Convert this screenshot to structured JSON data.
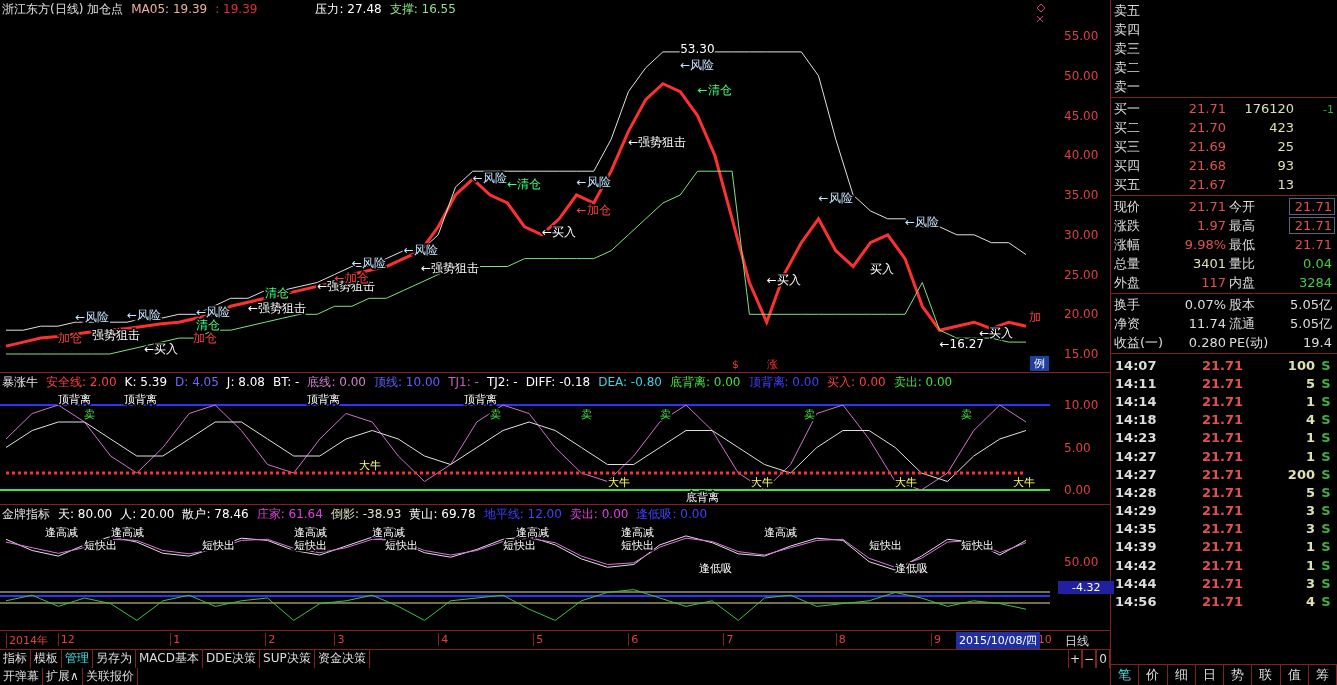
{
  "main": {
    "header": [
      {
        "text": "浙江东方(日线) 加仓点"
      },
      {
        "text": "MA05: 19.39",
        "color": "#f0b0a0"
      },
      {
        "text": ": 19.39",
        "color": "#e03030"
      },
      {
        "text": "压力: 27.48",
        "color": "#ffffff"
      },
      {
        "text": "支撑: 16.55",
        "color": "#90e090"
      }
    ],
    "chart_data": {
      "type": "line",
      "ylim": [
        15,
        55
      ],
      "yticks": [
        {
          "value": 55,
          "label": "55.00"
        },
        {
          "value": 50,
          "label": "50.00"
        },
        {
          "value": 45,
          "label": "45.00"
        },
        {
          "value": 40,
          "label": "40.00"
        },
        {
          "value": 35,
          "label": "35.00"
        },
        {
          "value": 30,
          "label": "30.00"
        },
        {
          "value": 25,
          "label": "25.00"
        },
        {
          "value": 20,
          "label": "20.00"
        },
        {
          "value": 15,
          "label": "15.00"
        }
      ],
      "series": [
        {
          "color": "#ff3030",
          "values": [
            16,
            16.5,
            17,
            17.2,
            17.5,
            17.8,
            18,
            18.2,
            18.5,
            18.8,
            19,
            19.5,
            20,
            21,
            21.5,
            22,
            22.5,
            23,
            23.5,
            24,
            25,
            25.5,
            26,
            27,
            28,
            31,
            35,
            37,
            35,
            34,
            31,
            30,
            32,
            35,
            34,
            38,
            43,
            47,
            49,
            48,
            45,
            40,
            32,
            24,
            19,
            25,
            29,
            32,
            28,
            26,
            29,
            30,
            27,
            21,
            18,
            18.5,
            19,
            18.2,
            19,
            18.5
          ]
        },
        {
          "color": "#e0e0e0",
          "values": [
            18,
            18,
            18.5,
            18.5,
            19,
            19,
            19,
            19,
            19.5,
            19.5,
            20,
            20,
            21,
            22,
            22,
            23,
            23,
            23.5,
            24,
            25,
            26,
            26,
            27,
            28,
            28,
            30,
            36,
            38,
            38,
            38,
            38,
            38,
            38,
            38,
            38,
            42,
            48,
            51,
            53,
            53,
            53,
            53,
            53,
            53,
            53,
            53,
            53,
            50,
            42,
            35,
            33,
            32,
            32,
            31,
            31,
            30,
            30,
            29,
            29,
            27.5
          ]
        },
        {
          "color": "#80e080",
          "values": [
            15,
            15,
            15,
            15,
            15,
            15,
            15,
            15.5,
            16,
            16.5,
            17,
            17,
            18,
            18,
            18.5,
            19,
            19.5,
            20,
            20,
            21,
            21,
            22,
            22,
            23,
            24,
            25,
            26,
            26,
            26,
            26,
            27,
            27,
            27,
            27,
            27,
            28,
            30,
            32,
            34,
            35,
            38,
            38,
            38,
            20,
            20,
            20,
            20,
            20,
            20,
            20,
            20,
            20,
            20,
            24,
            18,
            17,
            17,
            17,
            16.5,
            16.5
          ]
        }
      ]
    },
    "signals": [
      {
        "text": "加仓",
        "kind": "add"
      },
      {
        "text": "←风险",
        "kind": "risk"
      },
      {
        "text": "强势狙击",
        "kind": "strong"
      },
      {
        "text": "←风险",
        "kind": "risk"
      },
      {
        "text": "←买入",
        "kind": "buy"
      },
      {
        "text": "←风险",
        "kind": "risk"
      },
      {
        "text": "清仓",
        "kind": "clear"
      },
      {
        "text": "加仓",
        "kind": "add"
      },
      {
        "text": "←强势狙击",
        "kind": "strong"
      },
      {
        "text": "清仓",
        "kind": "clear"
      },
      {
        "text": "←强势狙击",
        "kind": "strong"
      },
      {
        "text": "←加仓",
        "kind": "add"
      },
      {
        "text": "←风险",
        "kind": "risk"
      },
      {
        "text": "←风险",
        "kind": "risk"
      },
      {
        "text": "←强势狙击",
        "kind": "strong"
      },
      {
        "text": "←风险",
        "kind": "risk"
      },
      {
        "text": "←清仓",
        "kind": "clear"
      },
      {
        "text": "←买入",
        "kind": "buy"
      },
      {
        "text": "←风险",
        "kind": "risk"
      },
      {
        "text": "←加仓",
        "kind": "add"
      },
      {
        "text": "←强势狙击",
        "kind": "strong"
      },
      {
        "text": "53.30",
        "kind": "price"
      },
      {
        "text": "←风险",
        "kind": "risk"
      },
      {
        "text": "←清仓",
        "kind": "clear"
      },
      {
        "text": "←买入",
        "kind": "buy"
      },
      {
        "text": "←风险",
        "kind": "risk"
      },
      {
        "text": "买入",
        "kind": "buy"
      },
      {
        "text": "←风险",
        "kind": "risk"
      },
      {
        "text": "←16.27",
        "kind": "price"
      },
      {
        "text": "←买入",
        "kind": "buy"
      },
      {
        "text": "加",
        "kind": "add"
      }
    ],
    "markers": [
      "$",
      "涨"
    ],
    "legend_tag": "例"
  },
  "osc": {
    "header": [
      {
        "text": "暴涨牛"
      },
      {
        "text": "安全线: 2.00",
        "color": "#ff4040"
      },
      {
        "text": "K: 5.39",
        "color": "#ffffff"
      },
      {
        "text": "D: 4.05",
        "color": "#6a6aff"
      },
      {
        "text": "J: 8.08",
        "color": "#ffffff"
      },
      {
        "text": "BT: -",
        "color": "#ffffff"
      },
      {
        "text": "底线: 0.00",
        "color": "#d080d0"
      },
      {
        "text": "顶线: 10.00",
        "color": "#6060ff"
      },
      {
        "text": "TJ1: -",
        "color": "#c060c0"
      },
      {
        "text": "TJ2: -",
        "color": "#ffffff"
      },
      {
        "text": "DIFF: -0.18",
        "color": "#ffffff"
      },
      {
        "text": "DEA: -0.80",
        "color": "#40d0e0"
      },
      {
        "text": "底背离: 0.00",
        "color": "#40e040"
      },
      {
        "text": "顶背离: 0.00",
        "color": "#4040ff"
      },
      {
        "text": "买入: 0.00",
        "color": "#ff4040"
      },
      {
        "text": "卖出: 0.00",
        "color": "#40e040"
      }
    ],
    "chart_data": {
      "type": "line",
      "ylim": [
        0,
        10
      ],
      "yticks": [
        {
          "value": 10,
          "label": "10.00"
        },
        {
          "value": 5,
          "label": "5.00"
        },
        {
          "value": 0,
          "label": "0.00"
        }
      ],
      "series": [
        {
          "color": "#d070d0",
          "values": [
            6,
            9,
            10,
            8,
            4,
            2,
            5,
            9,
            10,
            7,
            3,
            2,
            6,
            9,
            8,
            4,
            1,
            3,
            8,
            10,
            9,
            5,
            2,
            1,
            4,
            8,
            10,
            7,
            2,
            0,
            3,
            9,
            10,
            6,
            1,
            0,
            2,
            7,
            10,
            8
          ]
        },
        {
          "color": "#e0e0e0",
          "values": [
            5,
            7,
            8,
            8,
            6,
            4,
            4,
            6,
            8,
            8,
            6,
            4,
            4,
            6,
            7,
            6,
            4,
            3,
            5,
            7,
            8,
            7,
            5,
            3,
            3,
            5,
            7,
            7,
            5,
            3,
            2,
            5,
            7,
            7,
            5,
            2,
            1,
            4,
            6,
            7
          ]
        },
        {
          "color": "#ff3030",
          "line_style": "dotted",
          "values": [
            2,
            2,
            2,
            2,
            2,
            2,
            2,
            2,
            2,
            2,
            2,
            2,
            2,
            2,
            2,
            2,
            2,
            2,
            2,
            2,
            2,
            2,
            2,
            2,
            2,
            2,
            2,
            2,
            2,
            2,
            2,
            2,
            2,
            2,
            2,
            2,
            2,
            2,
            2,
            2
          ]
        }
      ]
    },
    "signals": [
      {
        "text": "顶背离",
        "kind": "top"
      },
      {
        "text": "顶背离",
        "kind": "top"
      },
      {
        "text": "顶背离",
        "kind": "top"
      },
      {
        "text": "顶背离",
        "kind": "top"
      },
      {
        "text": "卖",
        "kind": "sell"
      },
      {
        "text": "卖",
        "kind": "sell"
      },
      {
        "text": "卖",
        "kind": "sell"
      },
      {
        "text": "卖",
        "kind": "sell"
      },
      {
        "text": "卖",
        "kind": "sell"
      },
      {
        "text": "卖",
        "kind": "sell"
      },
      {
        "text": "大牛",
        "kind": "bull"
      },
      {
        "text": "大牛",
        "kind": "bull"
      },
      {
        "text": "大牛",
        "kind": "bull"
      },
      {
        "text": "大牛",
        "kind": "bull"
      },
      {
        "text": "大牛",
        "kind": "bull"
      },
      {
        "text": "底背离",
        "kind": "bottom"
      }
    ]
  },
  "gold": {
    "header": [
      {
        "text": "金牌指标"
      },
      {
        "text": "天: 80.00",
        "color": "#ffffff"
      },
      {
        "text": "人: 20.00",
        "color": "#ffffff"
      },
      {
        "text": "散户: 78.46",
        "color": "#ffffff"
      },
      {
        "text": "庄家: 61.64",
        "color": "#e040e0"
      },
      {
        "text": "倒影: -38.93",
        "color": "#e0e0c0"
      },
      {
        "text": "黄山: 69.78",
        "color": "#ffffff"
      },
      {
        "text": "地平线: 12.00",
        "color": "#4040ff"
      },
      {
        "text": "卖出: 0.00",
        "color": "#e040e0"
      },
      {
        "text": "逢低吸: 0.00",
        "color": "#4040ff"
      }
    ],
    "axis_label": "50.00",
    "readout": "-4.32",
    "signals": [
      "逢高减",
      "逢高减",
      "逢高减",
      "逢高减",
      "逢高减",
      "逢高减",
      "逢高减",
      "短快出",
      "短快出",
      "短快出",
      "短快出",
      "短快出",
      "短快出",
      "短快出",
      "短快出",
      "逢低吸",
      "逢低吸"
    ]
  },
  "date_axis": [
    "2014年",
    "12",
    "1",
    "2",
    "3",
    "4",
    "5",
    "6",
    "7",
    "8",
    "9",
    "10"
  ],
  "cursor_date": "2015/10/08/四",
  "period": "日线",
  "toolbar": {
    "tabs": [
      {
        "label": "指标",
        "selected": false
      },
      {
        "label": "模板",
        "selected": false
      },
      {
        "label": "管理",
        "selected": true
      },
      {
        "label": "另存为",
        "selected": false
      },
      {
        "label": "MACD基本",
        "selected": false
      },
      {
        "label": "DDE决策",
        "selected": false
      },
      {
        "label": "SUP决策",
        "selected": false
      },
      {
        "label": "资金决策",
        "selected": false
      }
    ],
    "buttons": [
      "+",
      "−",
      "0"
    ],
    "links": [
      "开弹幕",
      "扩展∧",
      "关联报价"
    ]
  },
  "quote": {
    "sell": [
      "卖五",
      "卖四",
      "卖三",
      "卖二",
      "卖一"
    ],
    "buy": [
      {
        "label": "买一",
        "price": "21.71",
        "volume": "176120",
        "change": "-1"
      },
      {
        "label": "买二",
        "price": "21.70",
        "volume": "423"
      },
      {
        "label": "买三",
        "price": "21.69",
        "volume": "25"
      },
      {
        "label": "买四",
        "price": "21.68",
        "volume": "93"
      },
      {
        "label": "买五",
        "price": "21.67",
        "volume": "13"
      }
    ],
    "stats": [
      {
        "label": "现价",
        "value": {
          "text": "21.71",
          "color": "#e05050"
        },
        "label2": "今开",
        "value2": {
          "text": "21.71",
          "color": "#e05050",
          "boxed": true
        }
      },
      {
        "label": "涨跌",
        "value": {
          "text": "1.97",
          "color": "#e05050"
        },
        "label2": "最高",
        "value2": {
          "text": "21.71",
          "color": "#e05050",
          "boxed": true
        }
      },
      {
        "label": "涨幅",
        "value": {
          "text": "9.98%",
          "color": "#e05050"
        },
        "label2": "最低",
        "value2": {
          "text": "21.71",
          "color": "#e05050",
          "boxed": false
        }
      },
      {
        "label": "总量",
        "value": {
          "text": "3401",
          "color": "#e0e0b0"
        },
        "label2": "量比",
        "value2": {
          "text": "0.04",
          "color": "#40d040",
          "boxed": false
        }
      },
      {
        "label": "外盘",
        "value": {
          "text": "117",
          "color": "#e05050"
        },
        "label2": "内盘",
        "value2": {
          "text": "3284",
          "color": "#40d040",
          "boxed": false
        }
      }
    ],
    "finance": [
      {
        "label": "换手",
        "value": "0.07%",
        "label2": "股本",
        "value2": "5.05亿"
      },
      {
        "label": "净资",
        "value": "11.74",
        "label2": "流通",
        "value2": "5.05亿"
      },
      {
        "label": "收益(一)",
        "value": "0.280",
        "label2": "PE(动)",
        "value2": "19.4"
      }
    ],
    "ticks": [
      {
        "time": "14:07",
        "price": "21.71",
        "volume": "100",
        "side": "S"
      },
      {
        "time": "14:11",
        "price": "21.71",
        "volume": "5",
        "side": "S"
      },
      {
        "time": "14:14",
        "price": "21.71",
        "volume": "1",
        "side": "S"
      },
      {
        "time": "14:18",
        "price": "21.71",
        "volume": "4",
        "side": "S"
      },
      {
        "time": "14:23",
        "price": "21.71",
        "volume": "1",
        "side": "S"
      },
      {
        "time": "14:27",
        "price": "21.71",
        "volume": "1",
        "side": "S"
      },
      {
        "time": "14:27",
        "price": "21.71",
        "volume": "200",
        "side": "S"
      },
      {
        "time": "14:28",
        "price": "21.71",
        "volume": "5",
        "side": "S"
      },
      {
        "time": "14:29",
        "price": "21.71",
        "volume": "3",
        "side": "S"
      },
      {
        "time": "14:35",
        "price": "21.71",
        "volume": "3",
        "side": "S"
      },
      {
        "time": "14:39",
        "price": "21.71",
        "volume": "1",
        "side": "S"
      },
      {
        "time": "14:42",
        "price": "21.71",
        "volume": "1",
        "side": "S"
      },
      {
        "time": "14:44",
        "price": "21.71",
        "volume": "3",
        "side": "S"
      },
      {
        "time": "14:56",
        "price": "21.71",
        "volume": "4",
        "side": "S"
      }
    ],
    "tabs": [
      {
        "label": "笔",
        "selected": true
      },
      {
        "label": "价",
        "selected": false
      },
      {
        "label": "细",
        "selected": false
      },
      {
        "label": "日",
        "selected": false
      },
      {
        "label": "势",
        "selected": false
      },
      {
        "label": "联",
        "selected": false
      },
      {
        "label": "值",
        "selected": false
      },
      {
        "label": "筹",
        "selected": false
      }
    ]
  }
}
